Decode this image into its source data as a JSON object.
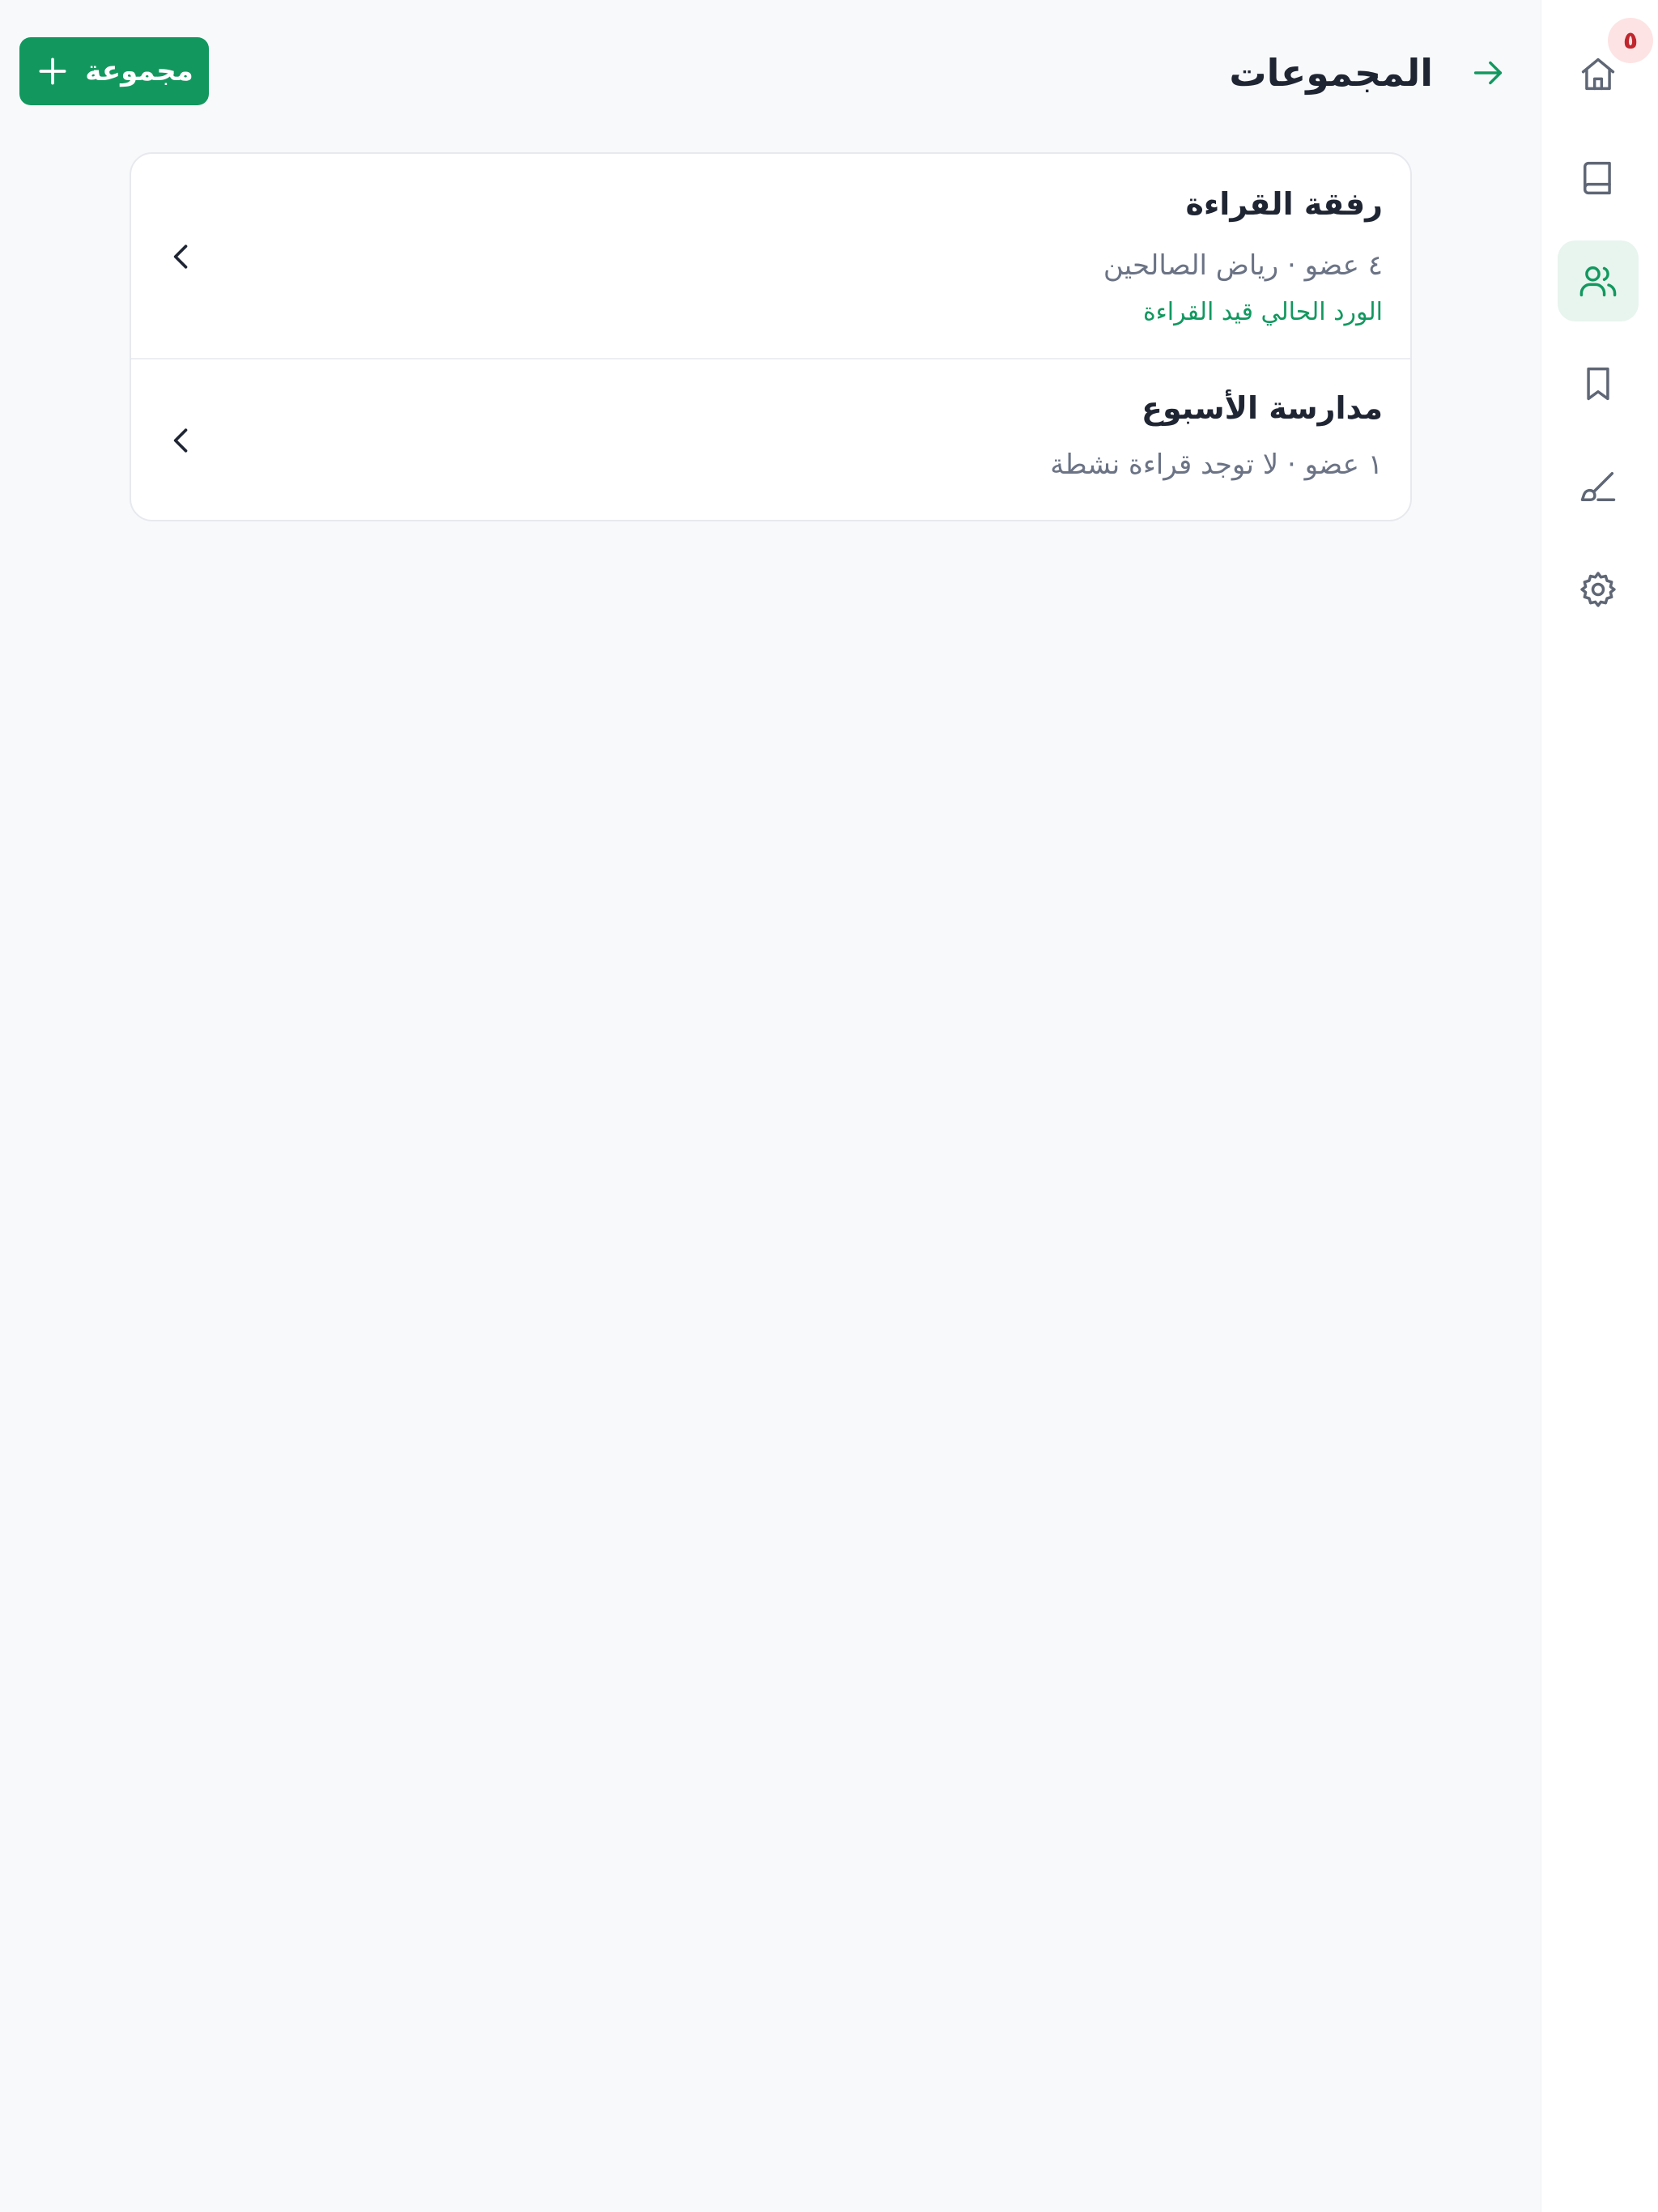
{
  "header": {
    "title": "المجموعات",
    "add_button_label": "مجموعة"
  },
  "sidebar": {
    "badge_count": "٥",
    "items": [
      {
        "name": "home",
        "icon": "home-icon",
        "active": false
      },
      {
        "name": "book",
        "icon": "book-icon",
        "active": false
      },
      {
        "name": "groups",
        "icon": "users-icon",
        "active": true
      },
      {
        "name": "bookmarks",
        "icon": "bookmark-icon",
        "active": false
      },
      {
        "name": "writing",
        "icon": "pen-icon",
        "active": false
      },
      {
        "name": "settings",
        "icon": "gear-icon",
        "active": false
      }
    ]
  },
  "groups": [
    {
      "name": "رفقة القراءة",
      "meta": "٤ عضو · رياض الصالحين",
      "status": "الورد الحالي قيد القراءة"
    },
    {
      "name": "مدارسة الأسبوع",
      "meta": "١ عضو · لا توجد قراءة نشطة"
    }
  ],
  "colors": {
    "accent": "#12985f",
    "active_nav_bg": "#e8f4ee",
    "badge_bg": "#fde3e3",
    "badge_text": "#c0262d",
    "icon_gray": "#5f6675"
  }
}
